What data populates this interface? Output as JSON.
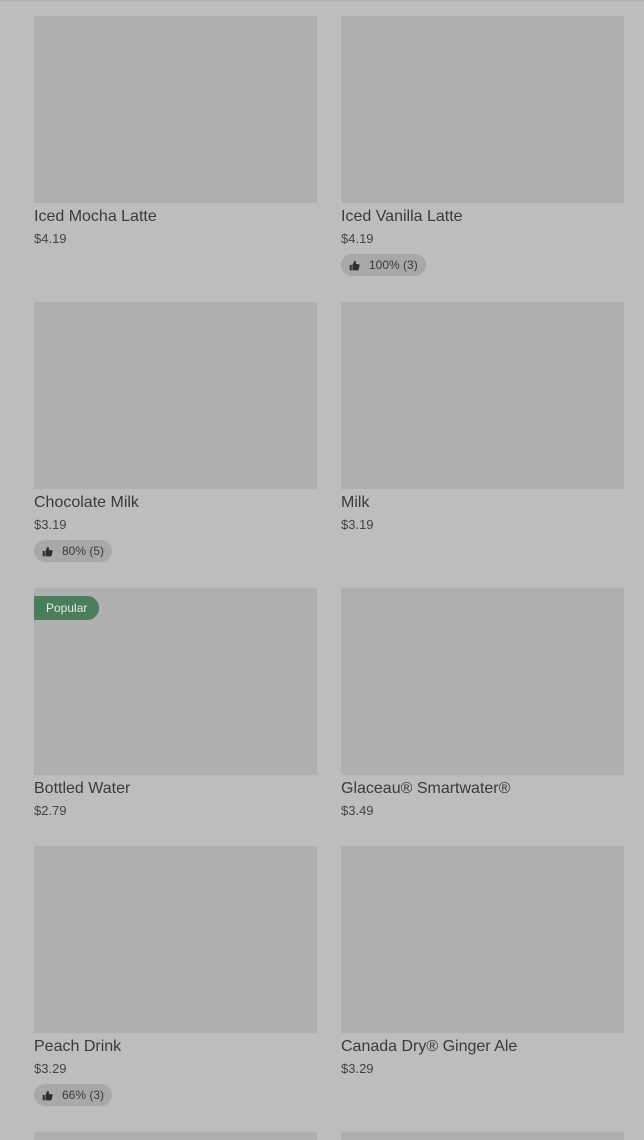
{
  "colors": {
    "overlay": "#bdbdbd",
    "thumbnail": "#afafaf",
    "popular_badge": "#4a7d5b",
    "rating_pill": "#a8a8a8"
  },
  "items": [
    {
      "name": "Iced Mocha Latte",
      "price": "$4.19",
      "rating": ""
    },
    {
      "name": "Iced Vanilla Latte",
      "price": "$4.19",
      "rating": "100% (3)"
    },
    {
      "name": "Chocolate Milk",
      "price": "$3.19",
      "rating": "80% (5)"
    },
    {
      "name": "Milk",
      "price": "$3.19",
      "rating": ""
    },
    {
      "name": "Bottled Water",
      "price": "$2.79",
      "rating": "",
      "badge": "Popular"
    },
    {
      "name": "Glaceau® Smartwater®",
      "price": "$3.49",
      "rating": ""
    },
    {
      "name": "Peach Drink",
      "price": "$3.29",
      "rating": "66% (3)"
    },
    {
      "name": "Canada Dry® Ginger Ale",
      "price": "$3.29",
      "rating": ""
    }
  ],
  "icons": {
    "rating": "thumbs-up-icon"
  }
}
